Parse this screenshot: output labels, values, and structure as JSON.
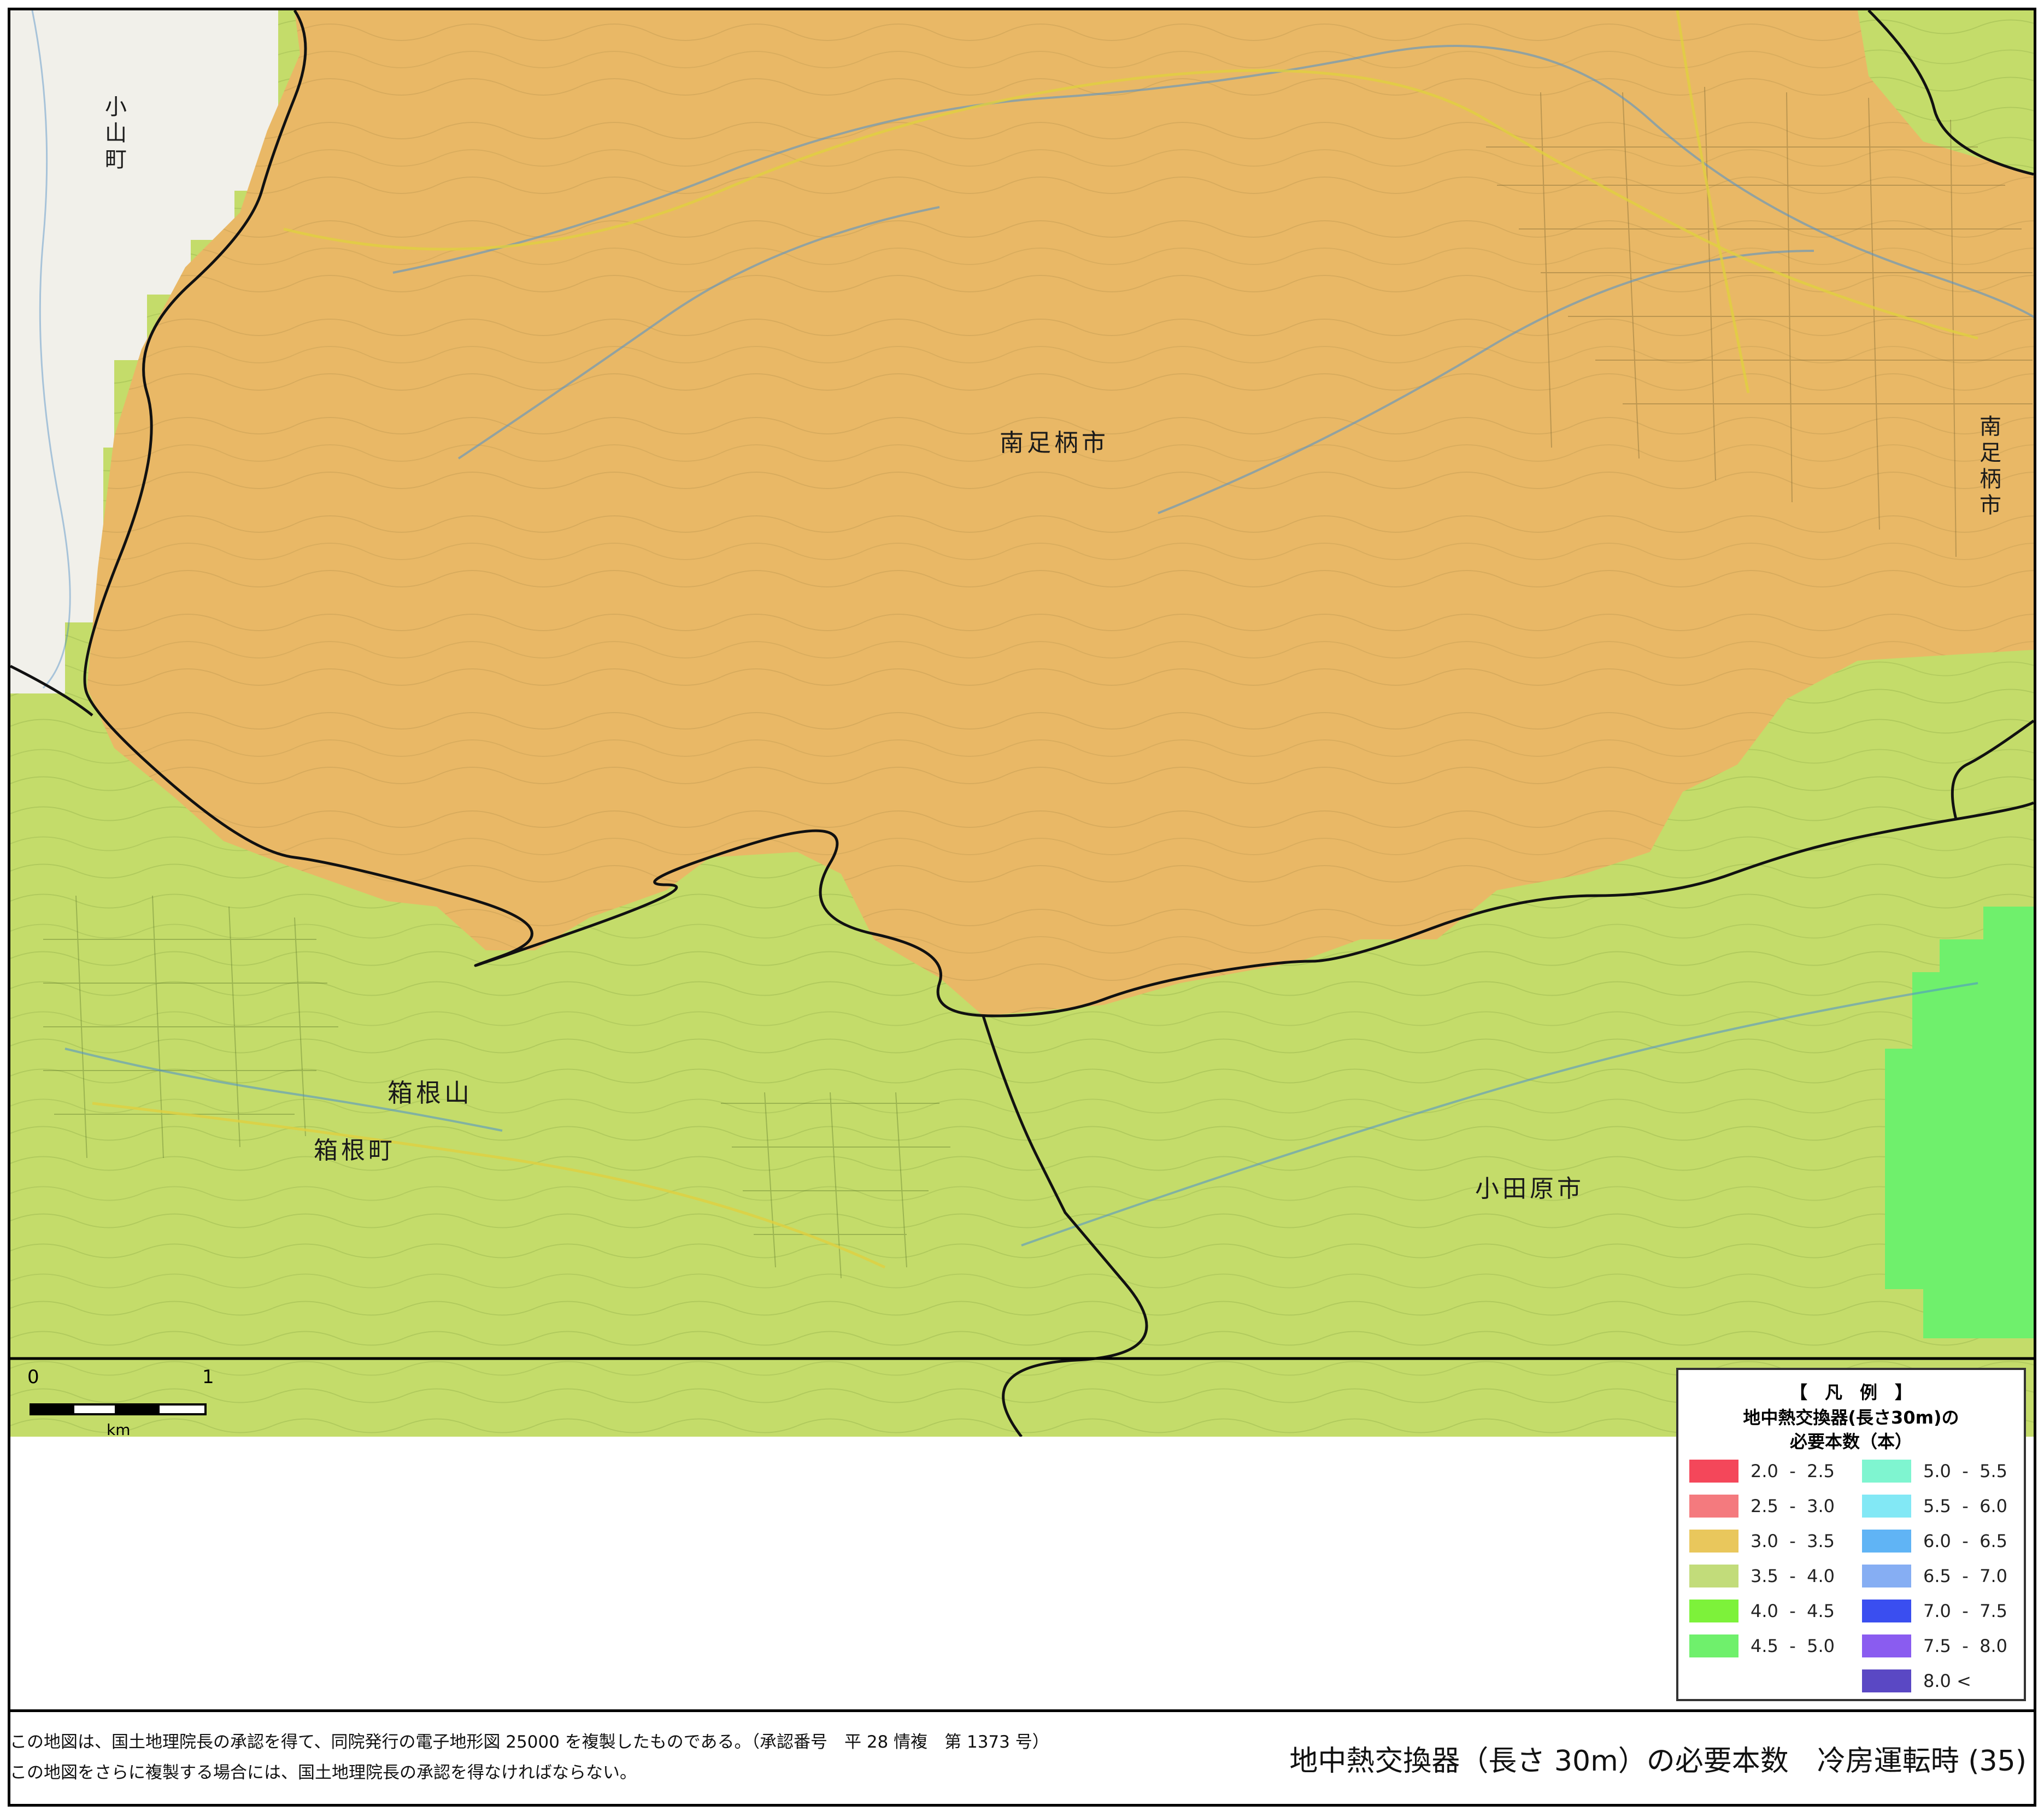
{
  "place_labels": {
    "oyama": "小山町",
    "minamiashigara_center": "南足柄市",
    "minamiashigara_edge": "南足柄市",
    "hakoneyama": "箱根山",
    "hakone_town": "箱根町",
    "odawara": "小田原市"
  },
  "scale_bar": {
    "start": "0",
    "end": "1",
    "unit": "km"
  },
  "legend": {
    "title_bracket": "【　凡　例　】",
    "title_line1": "地中熱交換器(長さ30m)の",
    "title_line2": "必要本数（本）",
    "items": [
      {
        "label": "2.0  -  2.5",
        "color": "#f4475a"
      },
      {
        "label": "2.5  -  3.0",
        "color": "#f47a7e"
      },
      {
        "label": "3.0  -  3.5",
        "color": "#e9c75c"
      },
      {
        "label": "3.5  -  4.0",
        "color": "#c2dc7a"
      },
      {
        "label": "4.0  -  4.5",
        "color": "#7df23a"
      },
      {
        "label": "4.5  -  5.0",
        "color": "#6ff06c"
      },
      {
        "label": "5.0  -  5.5",
        "color": "#7ff5d0"
      },
      {
        "label": "5.5  -  6.0",
        "color": "#82e8f5"
      },
      {
        "label": "6.0  -  6.5",
        "color": "#60b4f5"
      },
      {
        "label": "6.5  -  7.0",
        "color": "#86aef3"
      },
      {
        "label": "7.0  -  7.5",
        "color": "#3a4ef0"
      },
      {
        "label": "7.5  -  8.0",
        "color": "#8a5cf0"
      },
      {
        "label": "8.0 <",
        "color": "#5a48c4"
      }
    ]
  },
  "footer": {
    "note1": "この地図は、国土地理院長の承認を得て、同院発行の電子地形図 25000 を複製したものである。（承認番号　平 28 情複　第 1373 号）",
    "note2": "この地図をさらに複製する場合には、国土地理院長の承認を得なければならない。",
    "title": "地中熱交換器（長さ 30m）の必要本数　冷房運転時 (35)"
  },
  "map_colors": {
    "zone_3_0_3_5": "#e9b866",
    "zone_3_5_4_0": "#c4dc6a",
    "zone_4_5_5_0": "#6ff06c",
    "no_data": "#f1f0ea"
  }
}
